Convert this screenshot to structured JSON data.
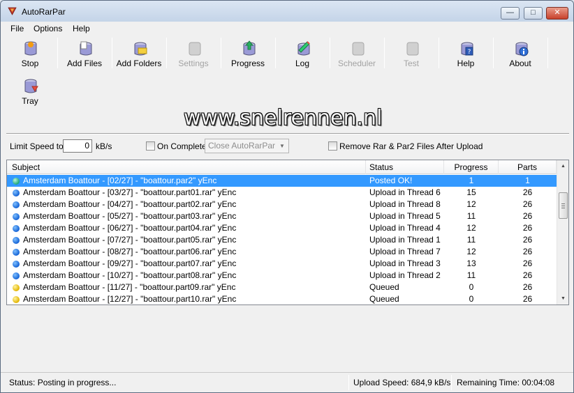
{
  "window": {
    "title": "AutoRarPar",
    "controls": {
      "minimize": "—",
      "maximize": "□",
      "close": "✕"
    }
  },
  "menu": [
    "File",
    "Options",
    "Help"
  ],
  "toolbar": {
    "buttons": [
      {
        "label": "Stop",
        "icon": "stop-icon",
        "enabled": true
      },
      {
        "label": "Add Files",
        "icon": "add-files-icon",
        "enabled": true
      },
      {
        "label": "Add Folders",
        "icon": "add-folders-icon",
        "enabled": true
      },
      {
        "label": "Settings",
        "icon": "settings-icon",
        "enabled": false
      },
      {
        "label": "Progress",
        "icon": "progress-icon",
        "enabled": true
      },
      {
        "label": "Log",
        "icon": "log-icon",
        "enabled": true
      },
      {
        "label": "Scheduler",
        "icon": "scheduler-icon",
        "enabled": false
      },
      {
        "label": "Test",
        "icon": "test-icon",
        "enabled": false
      },
      {
        "label": "Help",
        "icon": "help-icon",
        "enabled": true
      },
      {
        "label": "About",
        "icon": "about-icon",
        "enabled": true
      },
      {
        "label": "Tray",
        "icon": "tray-icon",
        "enabled": true
      }
    ]
  },
  "watermark": "www.snelrennen.nl",
  "options": {
    "limit_speed_label": "Limit Speed to:",
    "limit_speed_value": "0",
    "limit_speed_unit": "kB/s",
    "on_complete_label": "On Complete:",
    "on_complete_checked": false,
    "on_complete_value": "Close AutoRarPar",
    "remove_files_label": "Remove Rar & Par2 Files After Upload",
    "remove_files_checked": false
  },
  "list": {
    "columns": [
      "Subject",
      "Status",
      "Progress",
      "Parts"
    ],
    "rows": [
      {
        "subject": "Amsterdam Boattour - [02/27] - \"boattour.par2\" yEnc",
        "status": "Posted OK!",
        "progress": "1",
        "parts": "1",
        "state": "green",
        "selected": true
      },
      {
        "subject": "Amsterdam Boattour - [03/27] - \"boattour.part01.rar\" yEnc",
        "status": "Upload in Thread 6",
        "progress": "15",
        "parts": "26",
        "state": "blue",
        "selected": false
      },
      {
        "subject": "Amsterdam Boattour - [04/27] - \"boattour.part02.rar\" yEnc",
        "status": "Upload in Thread 8",
        "progress": "12",
        "parts": "26",
        "state": "blue",
        "selected": false
      },
      {
        "subject": "Amsterdam Boattour - [05/27] - \"boattour.part03.rar\" yEnc",
        "status": "Upload in Thread 5",
        "progress": "11",
        "parts": "26",
        "state": "blue",
        "selected": false
      },
      {
        "subject": "Amsterdam Boattour - [06/27] - \"boattour.part04.rar\" yEnc",
        "status": "Upload in Thread 4",
        "progress": "12",
        "parts": "26",
        "state": "blue",
        "selected": false
      },
      {
        "subject": "Amsterdam Boattour - [07/27] - \"boattour.part05.rar\" yEnc",
        "status": "Upload in Thread 1",
        "progress": "11",
        "parts": "26",
        "state": "blue",
        "selected": false
      },
      {
        "subject": "Amsterdam Boattour - [08/27] - \"boattour.part06.rar\" yEnc",
        "status": "Upload in Thread 7",
        "progress": "12",
        "parts": "26",
        "state": "blue",
        "selected": false
      },
      {
        "subject": "Amsterdam Boattour - [09/27] - \"boattour.part07.rar\" yEnc",
        "status": "Upload in Thread 3",
        "progress": "13",
        "parts": "26",
        "state": "blue",
        "selected": false
      },
      {
        "subject": "Amsterdam Boattour - [10/27] - \"boattour.part08.rar\" yEnc",
        "status": "Upload in Thread 2",
        "progress": "11",
        "parts": "26",
        "state": "blue",
        "selected": false
      },
      {
        "subject": "Amsterdam Boattour - [11/27] - \"boattour.part09.rar\" yEnc",
        "status": "Queued",
        "progress": "0",
        "parts": "26",
        "state": "yellow",
        "selected": false
      },
      {
        "subject": "Amsterdam Boattour - [12/27] - \"boattour.part10.rar\" yEnc",
        "status": "Queued",
        "progress": "0",
        "parts": "26",
        "state": "yellow",
        "selected": false
      }
    ]
  },
  "statusbar": {
    "status": "Status: Posting in progress...",
    "upload_speed": "Upload Speed: 684,9 kB/s",
    "remaining_time": "Remaining Time: 00:04:08"
  },
  "colors": {
    "selection": "#3399ff",
    "status_uploading": "#1463d6",
    "status_posted": "#1ea67a",
    "status_queued": "#e2b400"
  }
}
